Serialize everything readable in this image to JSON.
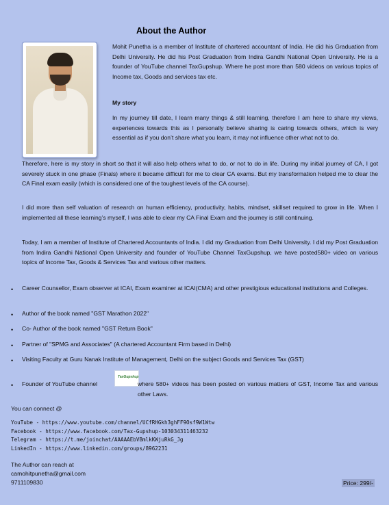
{
  "title": "About the Author",
  "intro": "Mohit Punetha is a member of Institute of chartered accountant of India. He did his Graduation from Delhi University. He did his Post Graduation from Indira Gandhi National Open University. He is a founder of YouTube channel TaxGupshup. Where he post more than 580 videos on various topics of Income tax, Goods and services tax etc.",
  "my_story_heading": "My story",
  "story_p1": "In my journey till date, I learn many things & still learning, therefore I am here to share my views, experiences towards this as I personally believe sharing is caring towards others, which is very essential as if you don’t share what you learn, it may not influence other what not to do.",
  "story_p2": "Therefore, here is my story in short so that it will also help others what to do, or not to do in life. During my initial journey of CA, I got severely stuck in one phase (Finals) where it became difficult for me to clear CA exams. But my transformation helped me to clear the CA Final exam easily (which is considered one of the toughest levels of the CA course).",
  "story_p3": "I did more than self valuation of research on human efficiency, productivity, habits, mindset, skillset required to grow in life. When I implemented all these learning’s myself, I was able to clear my CA Final Exam and the journey is still continuing.",
  "story_p4": "Today, I am a member of Institute of Chartered Accountants of India. I did my Graduation from Delhi University. I did my Post Graduation from Indira Gandhi National Open University and founder of YouTube Channel TaxGupshup, we have posted580+ video on various topics of Income Tax, Goods & Services Tax and various other matters.",
  "bullets": [
    "Career Counsellor, Exam observer at ICAI, Exam examiner at ICAI(CMA) and other prestigious educational institutions and Colleges.",
    "Author of the book named \"GST Marathon 2022\"",
    "Co- Author of the book named \"GST Return Book\"",
    "Partner of \"SPMG and Associates\" (A chartered Accountant Firm based in Delhi)",
    "Visiting Faculty at Guru Nanak Institute of Management, Delhi on the subject Goods and Services Tax (GST)"
  ],
  "bullet_last_before": "Founder of YouTube channel",
  "bullet_last_after": "where 580+ videos has been posted on various matters of GST, Income Tax and various other Laws.",
  "logo_text": "TaxGupshup",
  "connect_heading": "You can connect @",
  "links": [
    "YouTube - https://www.youtube.com/channel/UCfRHGkh3ghFF9Osf9W1Wtw",
    "Facebook - https://www.facebook.com/Tax-Gupshup-103034311463232",
    "Telegram - https://t.me/joinchat/AAAAAEbVBmlkKWjuRkG_Jg",
    "LinkedIn - https://www.linkedin.com/groups/8962231"
  ],
  "reach_heading": "The Author can reach at",
  "email": "camohitpunetha@gmail.com",
  "phone": "9711109830",
  "price": "Price: 299/-"
}
